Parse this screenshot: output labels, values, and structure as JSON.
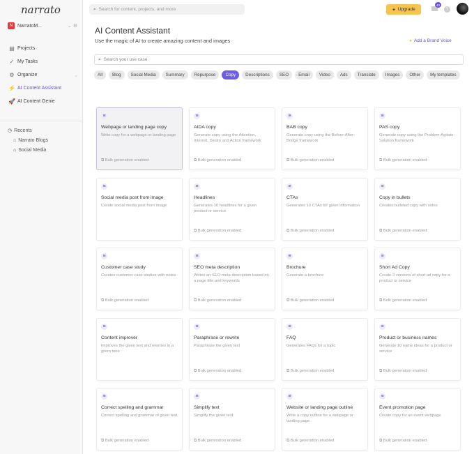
{
  "sidebar": {
    "logo": "narrato",
    "workspace": "NarratoM...",
    "workspace_initial": "N",
    "items": [
      {
        "label": "Projects",
        "icon": "▤"
      },
      {
        "label": "My Tasks",
        "icon": "✓"
      },
      {
        "label": "Organize",
        "icon": "⚙"
      },
      {
        "label": "AI Content Assistant",
        "icon": "⚡"
      },
      {
        "label": "AI Content Genie",
        "icon": "🚀"
      }
    ],
    "recents_label": "Recents",
    "recents": [
      "Narrato Blogs",
      "Social Media"
    ]
  },
  "topbar": {
    "search_placeholder": "Search for content, projects, and more",
    "upgrade": "Upgrade",
    "badge": "40",
    "help": "?"
  },
  "main": {
    "title": "AI Content Assistant",
    "subtitle": "Use the magic of AI to create amazing content and images",
    "brand_voice": "Add a Brand Voice",
    "usecase_placeholder": "Search your use case",
    "chips": [
      "All",
      "Blog",
      "Social Media",
      "Summary",
      "Repurpose",
      "Copy",
      "Descriptions",
      "SEO",
      "Email",
      "Video",
      "Ads",
      "Translate",
      "Images",
      "Other",
      "My templates"
    ],
    "selected_chip": "Copy",
    "cards": [
      {
        "title": "Webpage or landing page copy",
        "desc": "Write copy for a webpage or landing page",
        "bulk": "Bulk generation enabled"
      },
      {
        "title": "AIDA copy",
        "desc": "Generate copy using the Attention, Interest, Desire and Action framework",
        "bulk": "Bulk generation enabled"
      },
      {
        "title": "BAB copy",
        "desc": "Generate copy using the Before-After-Bridge framework",
        "bulk": "Bulk generation enabled"
      },
      {
        "title": "PAS copy",
        "desc": "Generate copy using the Problem-Agitate-Solution framework",
        "bulk": "Bulk generation enabled"
      },
      {
        "title": "Social media post from image",
        "desc": "Create social media post from image",
        "bulk": null
      },
      {
        "title": "Headlines",
        "desc": "Generates 10 headlines for a given product or service",
        "bulk": "Bulk generation enabled"
      },
      {
        "title": "CTAs",
        "desc": "Generates 10 CTAs for given information",
        "bulk": "Bulk generation enabled"
      },
      {
        "title": "Copy in bullets",
        "desc": "Creates bulleted copy with notes",
        "bulk": "Bulk generation enabled"
      },
      {
        "title": "Customer case study",
        "desc": "Creates customer case studies with notes",
        "bulk": "Bulk generation enabled"
      },
      {
        "title": "SEO meta description",
        "desc": "Writes an SEO meta description based on a page title and keywords",
        "bulk": "Bulk generation enabled"
      },
      {
        "title": "Brochure",
        "desc": "Generate a brochure",
        "bulk": "Bulk generation enabled"
      },
      {
        "title": "Short Ad Copy",
        "desc": "Create 3 versions of short ad copy for a product or service",
        "bulk": "Bulk generation enabled"
      },
      {
        "title": "Content improver",
        "desc": "Improves the given text and rewrites in a given tone",
        "bulk": null
      },
      {
        "title": "Paraphrase or rewrite",
        "desc": "Paraphrase the given text",
        "bulk": "Bulk generation enabled"
      },
      {
        "title": "FAQ",
        "desc": "Generates FAQs for a topic",
        "bulk": "Bulk generation enabled"
      },
      {
        "title": "Product or business names",
        "desc": "Generate 10 name ideas for a product or service",
        "bulk": "Bulk generation enabled"
      },
      {
        "title": "Correct spelling and grammar",
        "desc": "Correct spelling and grammar of given text",
        "bulk": "Bulk generation enabled"
      },
      {
        "title": "Simplify text",
        "desc": "Simplify the given text",
        "bulk": "Bulk generation enabled"
      },
      {
        "title": "Website or landing page outline",
        "desc": "Write a copy outline for a webpage or landing page",
        "bulk": "Bulk generation enabled"
      },
      {
        "title": "Event promotion page",
        "desc": "Create copy for an event webpage",
        "bulk": "Bulk generation enabled"
      }
    ]
  }
}
